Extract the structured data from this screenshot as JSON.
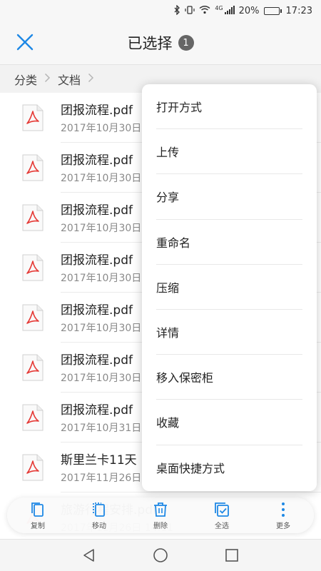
{
  "status_bar": {
    "network": "4G",
    "battery_percent": "20%",
    "time": "17:23",
    "battery_level": 0.2
  },
  "header": {
    "title": "已选择",
    "count": "1",
    "accent": "#1e88e5"
  },
  "breadcrumb": {
    "items": [
      "分类",
      "文档"
    ]
  },
  "files": [
    {
      "name": "团报流程.pdf",
      "date": "2017年10月30日"
    },
    {
      "name": "团报流程.pdf",
      "date": "2017年10月30日"
    },
    {
      "name": "团报流程.pdf",
      "date": "2017年10月30日"
    },
    {
      "name": "团报流程.pdf",
      "date": "2017年10月30日"
    },
    {
      "name": "团报流程.pdf",
      "date": "2017年10月30日"
    },
    {
      "name": "团报流程.pdf",
      "date": "2017年10月30日"
    },
    {
      "name": "团报流程.pdf",
      "date": "2017年10月31日"
    },
    {
      "name": "斯里兰卡11天",
      "date": "2017年11月26日"
    },
    {
      "name": "旅游行程安排.pdf",
      "date": "2017年11月26日 14:11"
    }
  ],
  "popup_menu": {
    "items": [
      "打开方式",
      "上传",
      "分享",
      "重命名",
      "压缩",
      "详情",
      "移入保密柜",
      "收藏",
      "桌面快捷方式"
    ]
  },
  "toolbar": {
    "copy": "复制",
    "move": "移动",
    "delete": "删除",
    "select_all": "全选",
    "more": "更多"
  },
  "icons": {
    "close": "close-icon",
    "pdf": "pdf-file-icon",
    "copy": "copy-icon",
    "move": "move-icon",
    "delete": "trash-icon",
    "select_all": "select-all-icon",
    "more": "more-vertical-icon",
    "back": "back-triangle-icon",
    "home": "home-circle-icon",
    "recents": "recents-square-icon"
  },
  "colors": {
    "accent": "#1e88e5",
    "pdf_red": "#e53935"
  }
}
